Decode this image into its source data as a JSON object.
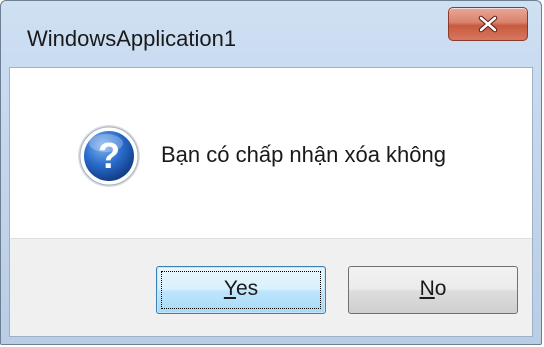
{
  "window": {
    "title": "WindowsApplication1",
    "close_label": "X"
  },
  "dialog": {
    "icon": "question-icon",
    "message": "Bạn có chấp nhận xóa không"
  },
  "buttons": {
    "yes": {
      "mnemonic": "Y",
      "rest": "es"
    },
    "no": {
      "mnemonic": "N",
      "rest": "o"
    }
  },
  "colors": {
    "titlebar": "#c4d7ee",
    "close_button": "#c75a3f",
    "icon_blue": "#1f5fb8",
    "button_area": "#f0f0f0",
    "default_button_border": "#3c7fb1"
  }
}
